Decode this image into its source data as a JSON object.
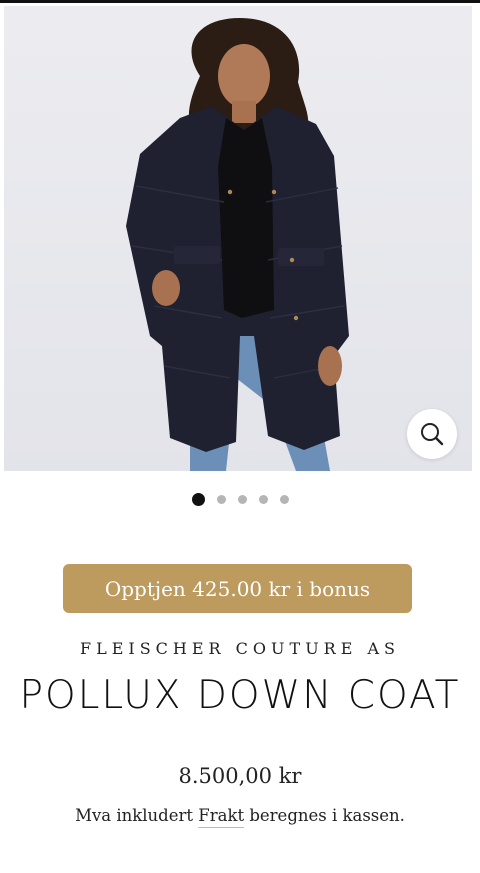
{
  "product": {
    "vendor": "FLEISCHER COUTURE AS",
    "title": "POLLUX DOWN COAT",
    "price": "8.500,00 kr",
    "tax_note": {
      "before": "Mva inkludert ",
      "link": "Frakt",
      "after": " beregnes i kassen."
    }
  },
  "bonus_button": {
    "label": "Opptjen 425.00 kr i bonus"
  },
  "gallery": {
    "image_count": 5,
    "active_index": 0,
    "zoom_icon": "search-icon"
  },
  "colors": {
    "bonus_bg": "#bd9a5e",
    "coat": "#1f2030",
    "jeans": "#6c8fb8",
    "photo_bg": "#e6e7ec"
  }
}
